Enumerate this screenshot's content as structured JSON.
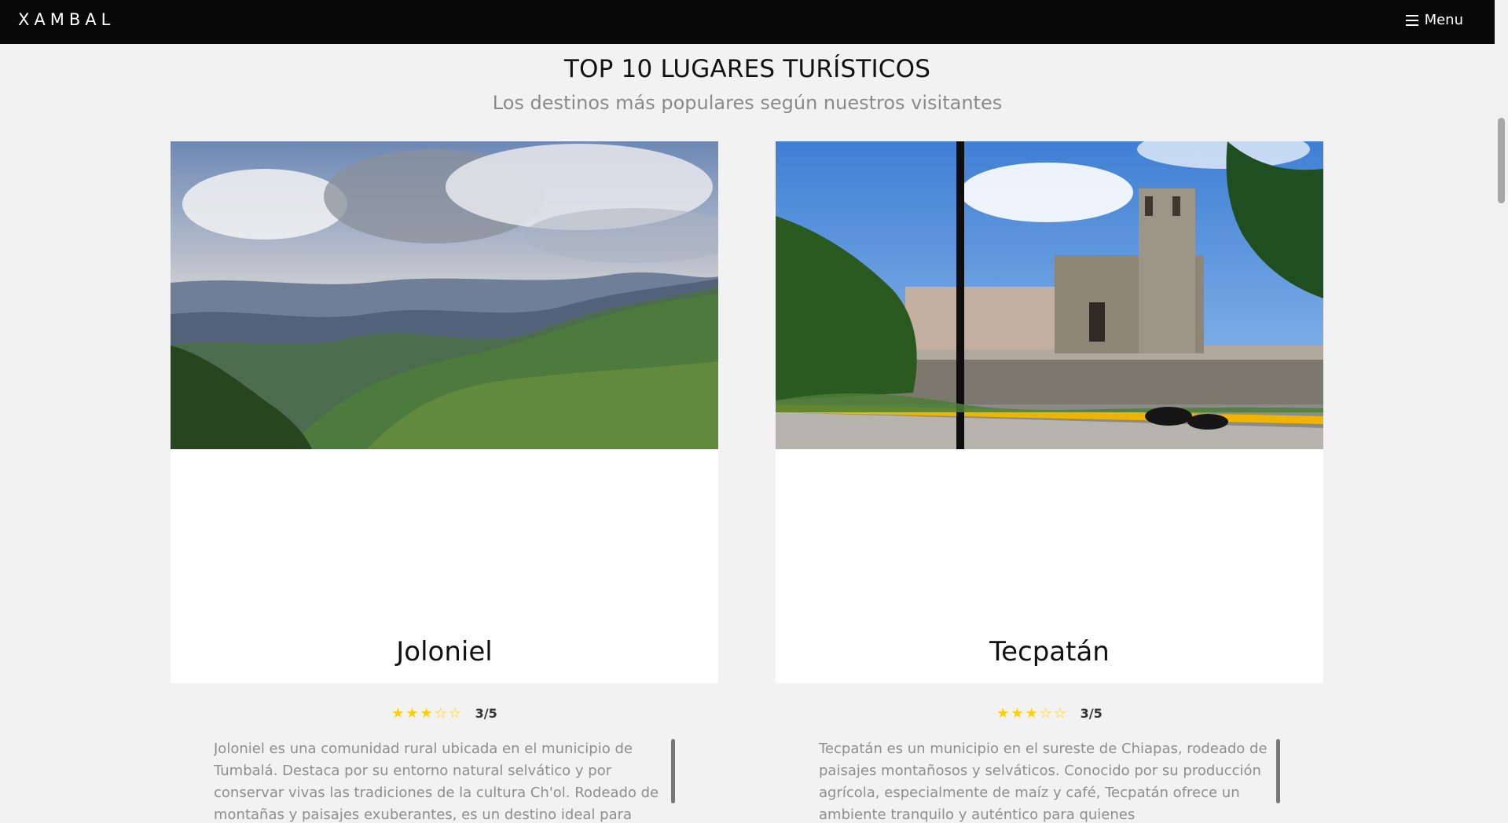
{
  "brand": "XAMBAL",
  "menu": {
    "label": "Menu",
    "icon": "hamburger-icon"
  },
  "hero": {
    "title": "TOP 10 LUGARES TURÍSTICOS",
    "subtitle": "Los destinos más populares según nuestros visitantes"
  },
  "cards": [
    {
      "title": "Joloniel",
      "rating": "3/5",
      "stars": "★★★☆☆",
      "description": "Joloniel es una comunidad rural ubicada en el municipio de Tumbalá. Destaca por su entorno natural selvático y por conservar vivas las tradiciones de la cultura Ch'ol. Rodeado de montañas y paisajes exuberantes, es un destino ideal para"
    },
    {
      "title": "Tecpatán",
      "rating": "3/5",
      "stars": "★★★☆☆",
      "description": "Tecpatán es un municipio en el sureste de Chiapas, rodeado de paisajes montañosos y selváticos. Conocido por su producción agrícola, especialmente de maíz y café, Tecpatán ofrece un ambiente tranquilo y auténtico para quienes"
    }
  ]
}
